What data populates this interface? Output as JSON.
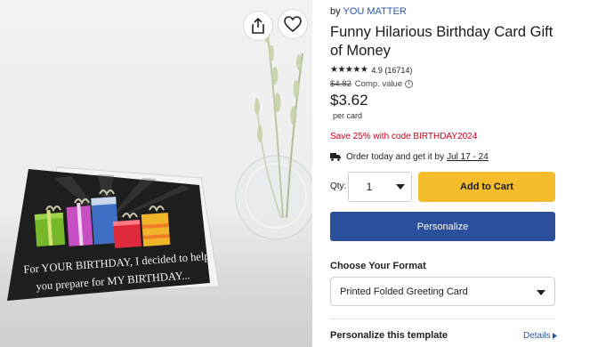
{
  "product": {
    "by_prefix": "by",
    "seller": "YOU MATTER",
    "title": "Funny Hilarious Birthday Card Gift of Money",
    "stars": "★★★★★",
    "rating": "4.9",
    "review_count": "(16714)",
    "compare_price": "$4.82",
    "compare_label": "Comp. value",
    "price": "$3.62",
    "price_unit": "per card",
    "promo": "Save 25% with code BIRTHDAY2024",
    "shipping_text": "Order today and get it by",
    "shipping_dates": "Jul 17 - 24"
  },
  "image": {
    "card_text_line1": "For YOUR BIRTHDAY, I decided to help",
    "card_text_line2": "you prepare for MY BIRTHDAY..."
  },
  "purchase": {
    "qty_label": "Qty:",
    "qty_value": "1",
    "add_to_cart": "Add to Cart",
    "personalize": "Personalize"
  },
  "format": {
    "label": "Choose Your Format",
    "selected": "Printed Folded Greeting Card"
  },
  "template": {
    "label": "Personalize this template",
    "details": "Details"
  },
  "colors": {
    "accent_yellow": "#f5bd2c",
    "primary_blue": "#2b4f9a",
    "link_blue": "#2b56a8",
    "promo_red": "#d6001c"
  },
  "icons": {
    "share": "share-icon",
    "favorite": "heart-icon",
    "rating_info": "info-icon",
    "shipping": "truck-icon",
    "qty_dropdown": "caret-down-icon",
    "format_dropdown": "caret-down-icon",
    "details": "chevron-right-icon"
  }
}
